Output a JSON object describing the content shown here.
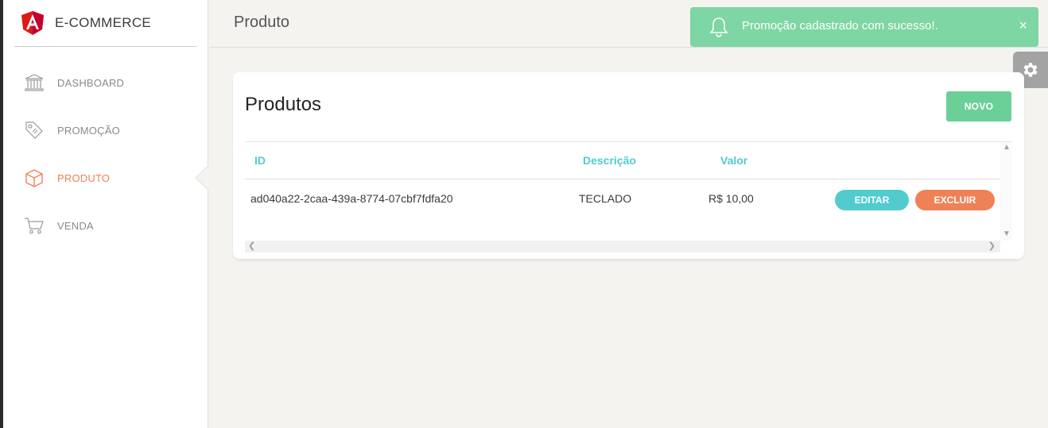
{
  "brand": {
    "title": "E-COMMERCE",
    "logo_icon": "angular-logo-icon",
    "logo_color": "#dd1b16"
  },
  "nav": {
    "items": [
      {
        "label": "DASHBOARD",
        "icon": "bank-icon",
        "active": false
      },
      {
        "label": "PROMOÇÃO",
        "icon": "tag-icon",
        "active": false
      },
      {
        "label": "PRODUTO",
        "icon": "box-icon",
        "active": true
      },
      {
        "label": "VENDA",
        "icon": "cart-icon",
        "active": false
      }
    ],
    "active_color": "#ef8157"
  },
  "topbar": {
    "page_title": "Produto"
  },
  "toast": {
    "message": "Promoção cadastrado com sucesso!.",
    "icon": "bell-icon",
    "close_label": "×",
    "color": "#7dd6a3"
  },
  "settings": {
    "icon": "gear-icon"
  },
  "card": {
    "title": "Produtos",
    "new_button": "NOVO",
    "table": {
      "headers": {
        "id": "ID",
        "descricao": "Descrição",
        "valor": "Valor"
      },
      "rows": [
        {
          "id": "ad040a22-2caa-439a-8774-07cbf7fdfa20",
          "descricao": "TECLADO",
          "valor": "R$ 10,00",
          "edit_label": "EDITAR",
          "delete_label": "EXCLUIR"
        }
      ]
    }
  },
  "colors": {
    "primary": "#51cbce",
    "success": "#6bd098",
    "danger": "#ef8157"
  }
}
